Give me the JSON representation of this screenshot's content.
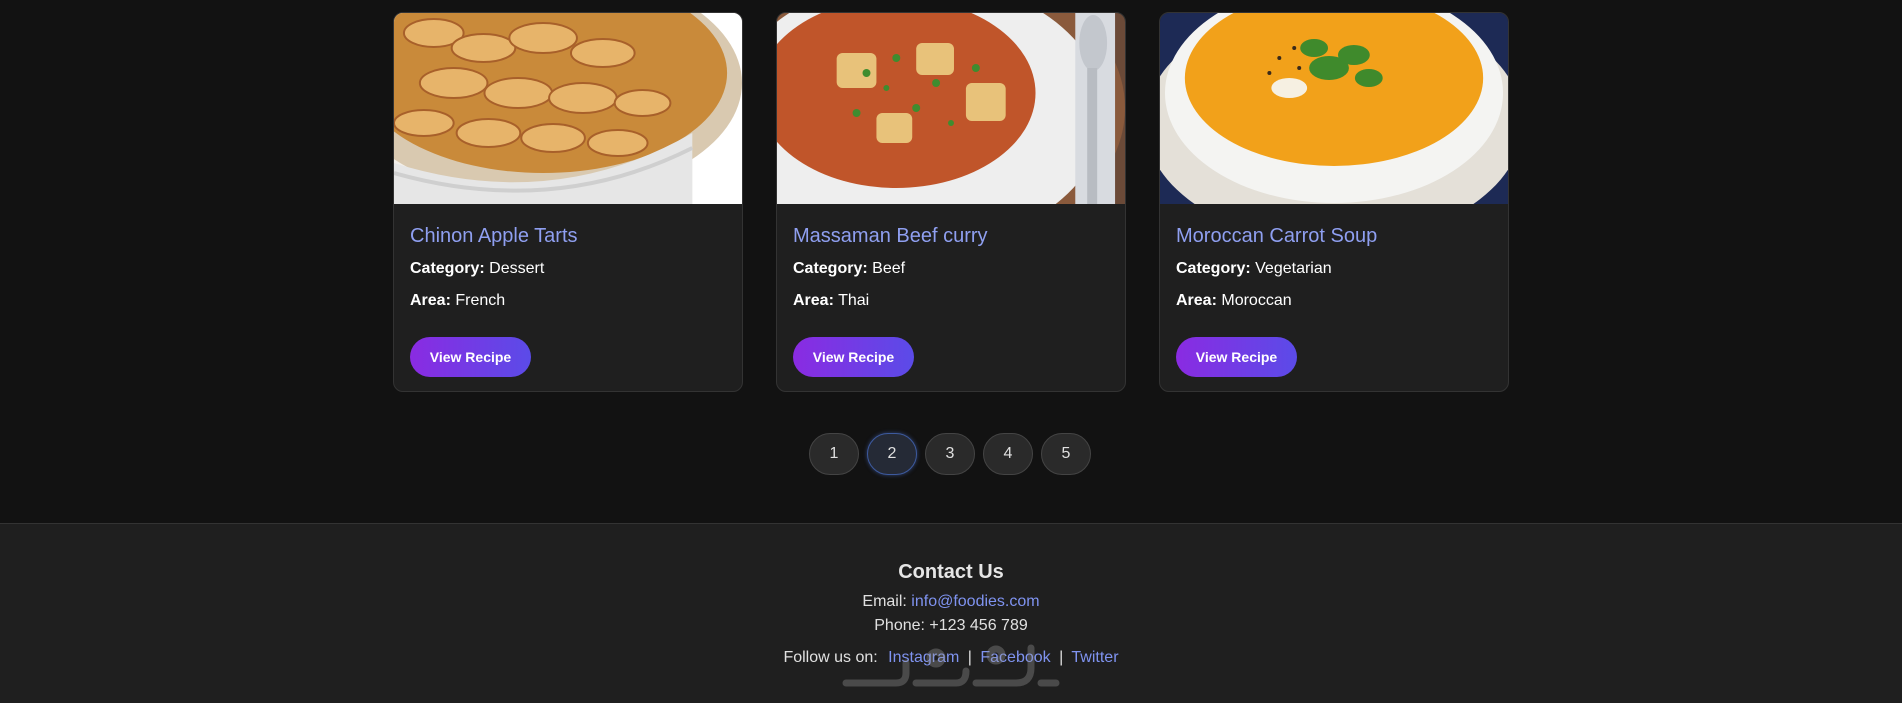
{
  "recipes": [
    {
      "title": "Chinon Apple Tarts",
      "category_label": "Category:",
      "category": "Dessert",
      "area_label": "Area:",
      "area": "French",
      "button": "View Recipe",
      "image_icon": "apple-tart-photo"
    },
    {
      "title": "Massaman Beef curry",
      "category_label": "Category:",
      "category": "Beef",
      "area_label": "Area:",
      "area": "Thai",
      "button": "View Recipe",
      "image_icon": "beef-curry-photo"
    },
    {
      "title": "Moroccan Carrot Soup",
      "category_label": "Category:",
      "category": "Vegetarian",
      "area_label": "Area:",
      "area": "Moroccan",
      "button": "View Recipe",
      "image_icon": "carrot-soup-photo"
    }
  ],
  "pagination": {
    "pages": [
      "1",
      "2",
      "3",
      "4",
      "5"
    ],
    "current": "2"
  },
  "footer": {
    "title": "Contact Us",
    "email_label": "Email:",
    "email": "info@foodies.com",
    "phone_label": "Phone:",
    "phone": "+123 456 789",
    "follow_label": "Follow us on:",
    "links": [
      "Instagram",
      "Facebook",
      "Twitter"
    ],
    "separator": "|"
  },
  "colors": {
    "background": "#121212",
    "card": "#1f1f1f",
    "title_accent": "#8f9ff0",
    "button_gradient_start": "#8a2be2",
    "button_gradient_end": "#5b4be8",
    "link": "#7f93f0"
  }
}
